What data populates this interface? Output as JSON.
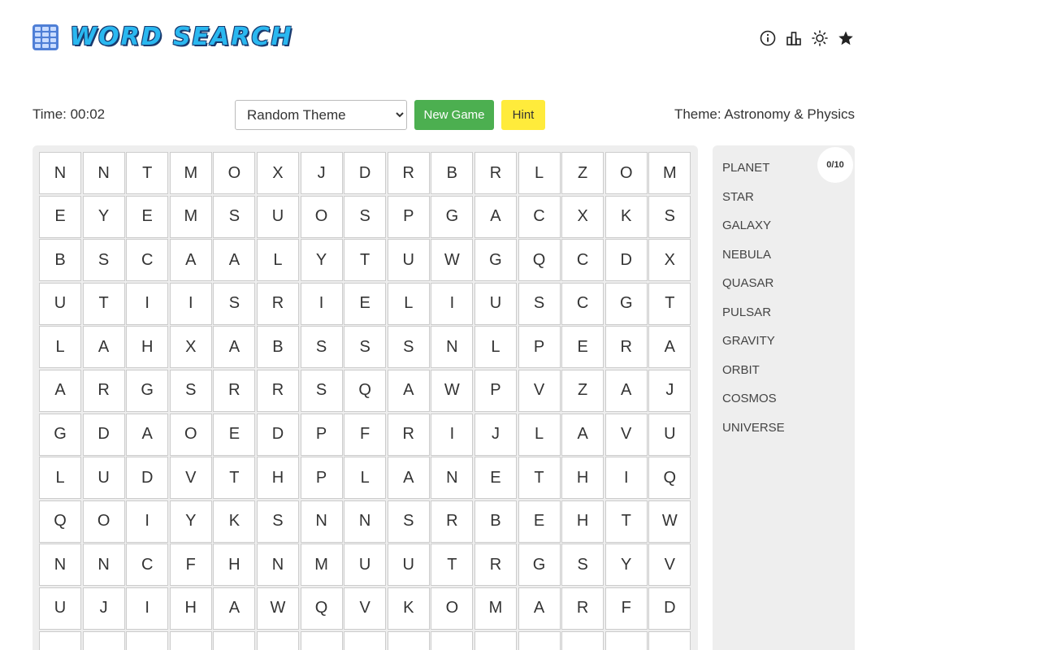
{
  "header": {
    "title": "WORD SEARCH",
    "icons": [
      "info-icon",
      "stats-icon",
      "theme-toggle-icon",
      "star-icon"
    ]
  },
  "controls": {
    "timer": "Time: 00:02",
    "theme_select": {
      "selected": "Random Theme"
    },
    "new_game_label": "New Game",
    "hint_label": "Hint",
    "theme_label": "Theme: Astronomy & Physics"
  },
  "grid": {
    "rows": [
      [
        "N",
        "N",
        "T",
        "M",
        "O",
        "X",
        "J",
        "D",
        "R",
        "B",
        "R",
        "L",
        "Z",
        "O",
        "M"
      ],
      [
        "E",
        "Y",
        "E",
        "M",
        "S",
        "U",
        "O",
        "S",
        "P",
        "G",
        "A",
        "C",
        "X",
        "K",
        "S"
      ],
      [
        "B",
        "S",
        "C",
        "A",
        "A",
        "L",
        "Y",
        "T",
        "U",
        "W",
        "G",
        "Q",
        "C",
        "D",
        "X"
      ],
      [
        "U",
        "T",
        "I",
        "I",
        "S",
        "R",
        "I",
        "E",
        "L",
        "I",
        "U",
        "S",
        "C",
        "G",
        "T"
      ],
      [
        "L",
        "A",
        "H",
        "X",
        "A",
        "B",
        "S",
        "S",
        "S",
        "N",
        "L",
        "P",
        "E",
        "R",
        "A"
      ],
      [
        "A",
        "R",
        "G",
        "S",
        "R",
        "R",
        "S",
        "Q",
        "A",
        "W",
        "P",
        "V",
        "Z",
        "A",
        "J"
      ],
      [
        "G",
        "D",
        "A",
        "O",
        "E",
        "D",
        "P",
        "F",
        "R",
        "I",
        "J",
        "L",
        "A",
        "V",
        "U"
      ],
      [
        "L",
        "U",
        "D",
        "V",
        "T",
        "H",
        "P",
        "L",
        "A",
        "N",
        "E",
        "T",
        "H",
        "I",
        "Q"
      ],
      [
        "Q",
        "O",
        "I",
        "Y",
        "K",
        "S",
        "N",
        "N",
        "S",
        "R",
        "B",
        "E",
        "H",
        "T",
        "W"
      ],
      [
        "N",
        "N",
        "C",
        "F",
        "H",
        "N",
        "M",
        "U",
        "U",
        "T",
        "R",
        "G",
        "S",
        "Y",
        "V"
      ],
      [
        "U",
        "J",
        "I",
        "H",
        "A",
        "W",
        "Q",
        "V",
        "K",
        "O",
        "M",
        "A",
        "R",
        "F",
        "D"
      ],
      [
        "",
        "",
        "",
        "",
        "",
        "",
        "",
        "",
        "",
        "",
        "",
        "",
        "",
        "",
        ""
      ]
    ]
  },
  "words": {
    "progress": "0/10",
    "list": [
      "PLANET",
      "STAR",
      "GALAXY",
      "NEBULA",
      "QUASAR",
      "PULSAR",
      "GRAVITY",
      "ORBIT",
      "COSMOS",
      "UNIVERSE"
    ]
  },
  "colors": {
    "new_game": "#4caf50",
    "hint": "#ffeb3b",
    "title": "#2ab8f0",
    "panel_bg": "#eeeeee"
  }
}
